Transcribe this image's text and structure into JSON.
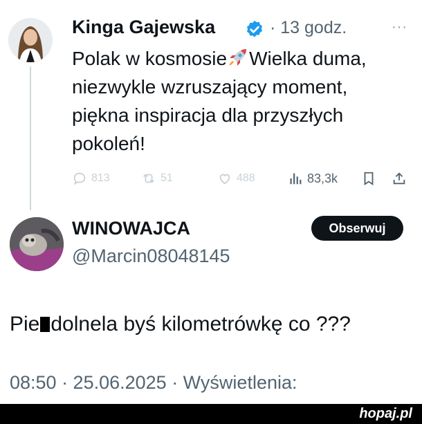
{
  "tweet1": {
    "author_name": "Kinga Gajewska",
    "time": "· 13 godz.",
    "more": "···",
    "text_part1": "Polak w kosmosie",
    "text_part2": "Wielka duma, niezwykle wzruszający moment, piękna inspiracja dla przyszłych pokoleń!",
    "actions": {
      "replies": "813",
      "reposts": "51",
      "likes": "488",
      "views": "83,3k"
    }
  },
  "tweet2": {
    "author_name": "WINOWAJCA",
    "handle": "@Marcin08048145",
    "follow_label": "Obserwuj",
    "text_part1": "Pie",
    "text_part2": "dolnela byś kilometrówkę co ???",
    "timestamp": "08:50 · 25.06.2025 · Wyświetlenia:"
  },
  "watermark": "hopaj.pl",
  "colors": {
    "verified_blue": "#1d9bf0",
    "muted": "#536471",
    "follow_bg": "#0f1419"
  }
}
